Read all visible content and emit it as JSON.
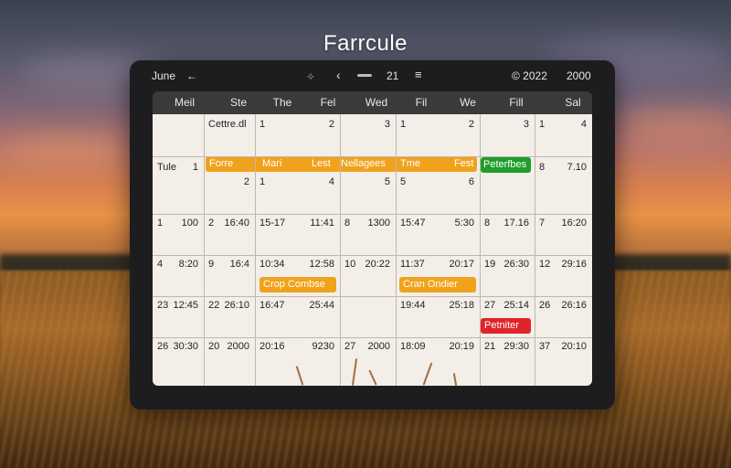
{
  "app_title": "Farrcule",
  "toolbar": {
    "month": "June",
    "back_arrow": "←",
    "nav_diamond": "⟡",
    "prev_chevron": "‹",
    "day_number": "21",
    "menu_glyph": "≡",
    "year_left": "© 2022",
    "year_right": "2000"
  },
  "weekdays": [
    "Meil",
    "Ste",
    "The",
    "Fel",
    "Wed",
    "Fil",
    "We",
    "Fill",
    "Sal"
  ],
  "rows": [
    {
      "cells": [
        [
          ""
        ],
        [
          "Cettre.dl"
        ],
        [
          "1",
          "2"
        ],
        [
          "",
          "3"
        ],
        [
          "1",
          "2"
        ],
        [
          "",
          "3"
        ],
        [
          "1",
          "4"
        ]
      ]
    },
    {
      "cells": [
        [
          "Tule",
          "1"
        ],
        [
          "",
          "2"
        ],
        [
          "1",
          "4"
        ],
        [
          "",
          "5"
        ],
        [
          "5",
          "6"
        ],
        [
          "",
          ""
        ],
        [
          "8",
          "7.10"
        ]
      ]
    },
    {
      "cells": [
        [
          "1",
          "100"
        ],
        [
          "2",
          "16:40"
        ],
        [
          "15-17",
          "11:41"
        ],
        [
          "8",
          "1300"
        ],
        [
          "15:47",
          "5:30"
        ],
        [
          "8",
          "17.16"
        ],
        [
          "7",
          "16:20"
        ]
      ]
    },
    {
      "cells": [
        [
          "4",
          "8:20"
        ],
        [
          "9",
          "16:4"
        ],
        [
          "10:34",
          "12:58"
        ],
        [
          "10",
          "20:22"
        ],
        [
          "11:37",
          "20:17"
        ],
        [
          "19",
          "26:30"
        ],
        [
          "12",
          "29:16"
        ]
      ]
    },
    {
      "cells": [
        [
          "23",
          "12:45"
        ],
        [
          "22",
          "26:10"
        ],
        [
          "16:47",
          "25:44"
        ],
        [
          "",
          ""
        ],
        [
          "19:44",
          "25:18"
        ],
        [
          "27",
          "25:14"
        ],
        [
          "26",
          "26:16"
        ]
      ]
    },
    {
      "cells": [
        [
          "26",
          "30:30"
        ],
        [
          "20",
          "2000"
        ],
        [
          "20:16",
          "9230"
        ],
        [
          "27",
          "2000"
        ],
        [
          "18:09",
          "20:19"
        ],
        [
          "21",
          "29:30"
        ],
        [
          "37",
          "20:10"
        ]
      ]
    }
  ],
  "events": {
    "orange_band": {
      "labels": [
        "Forre",
        "Mari",
        "Lest",
        "Nellagees",
        "Tme",
        "Fest"
      ]
    },
    "green": {
      "label": "Peterfbes"
    },
    "crop1": {
      "label": "Crop Combse"
    },
    "crop2": {
      "label": "Cran Ondier"
    },
    "red": {
      "label": "Petniter"
    }
  },
  "colors": {
    "orange": "#f0a21c",
    "green": "#1f9e2b",
    "red": "#e0242a",
    "grid_bg": "#f3efe8",
    "header_bg": "#3a3a3c"
  }
}
